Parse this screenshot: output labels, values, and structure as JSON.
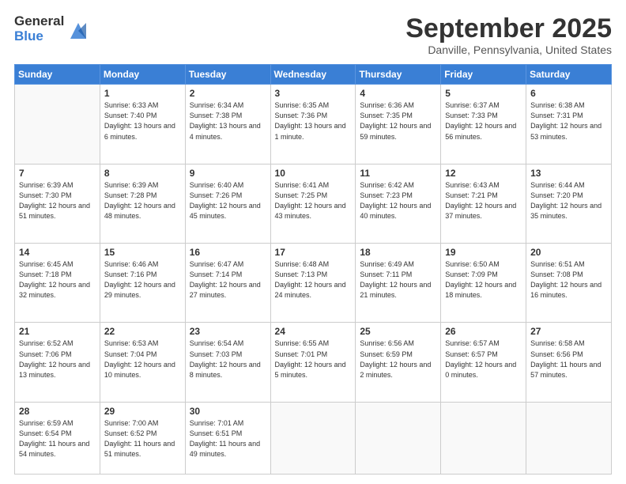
{
  "logo": {
    "general": "General",
    "blue": "Blue"
  },
  "header": {
    "month": "September 2025",
    "location": "Danville, Pennsylvania, United States"
  },
  "weekdays": [
    "Sunday",
    "Monday",
    "Tuesday",
    "Wednesday",
    "Thursday",
    "Friday",
    "Saturday"
  ],
  "weeks": [
    [
      {
        "day": "",
        "sunrise": "",
        "sunset": "",
        "daylight": ""
      },
      {
        "day": "1",
        "sunrise": "Sunrise: 6:33 AM",
        "sunset": "Sunset: 7:40 PM",
        "daylight": "Daylight: 13 hours and 6 minutes."
      },
      {
        "day": "2",
        "sunrise": "Sunrise: 6:34 AM",
        "sunset": "Sunset: 7:38 PM",
        "daylight": "Daylight: 13 hours and 4 minutes."
      },
      {
        "day": "3",
        "sunrise": "Sunrise: 6:35 AM",
        "sunset": "Sunset: 7:36 PM",
        "daylight": "Daylight: 13 hours and 1 minute."
      },
      {
        "day": "4",
        "sunrise": "Sunrise: 6:36 AM",
        "sunset": "Sunset: 7:35 PM",
        "daylight": "Daylight: 12 hours and 59 minutes."
      },
      {
        "day": "5",
        "sunrise": "Sunrise: 6:37 AM",
        "sunset": "Sunset: 7:33 PM",
        "daylight": "Daylight: 12 hours and 56 minutes."
      },
      {
        "day": "6",
        "sunrise": "Sunrise: 6:38 AM",
        "sunset": "Sunset: 7:31 PM",
        "daylight": "Daylight: 12 hours and 53 minutes."
      }
    ],
    [
      {
        "day": "7",
        "sunrise": "Sunrise: 6:39 AM",
        "sunset": "Sunset: 7:30 PM",
        "daylight": "Daylight: 12 hours and 51 minutes."
      },
      {
        "day": "8",
        "sunrise": "Sunrise: 6:39 AM",
        "sunset": "Sunset: 7:28 PM",
        "daylight": "Daylight: 12 hours and 48 minutes."
      },
      {
        "day": "9",
        "sunrise": "Sunrise: 6:40 AM",
        "sunset": "Sunset: 7:26 PM",
        "daylight": "Daylight: 12 hours and 45 minutes."
      },
      {
        "day": "10",
        "sunrise": "Sunrise: 6:41 AM",
        "sunset": "Sunset: 7:25 PM",
        "daylight": "Daylight: 12 hours and 43 minutes."
      },
      {
        "day": "11",
        "sunrise": "Sunrise: 6:42 AM",
        "sunset": "Sunset: 7:23 PM",
        "daylight": "Daylight: 12 hours and 40 minutes."
      },
      {
        "day": "12",
        "sunrise": "Sunrise: 6:43 AM",
        "sunset": "Sunset: 7:21 PM",
        "daylight": "Daylight: 12 hours and 37 minutes."
      },
      {
        "day": "13",
        "sunrise": "Sunrise: 6:44 AM",
        "sunset": "Sunset: 7:20 PM",
        "daylight": "Daylight: 12 hours and 35 minutes."
      }
    ],
    [
      {
        "day": "14",
        "sunrise": "Sunrise: 6:45 AM",
        "sunset": "Sunset: 7:18 PM",
        "daylight": "Daylight: 12 hours and 32 minutes."
      },
      {
        "day": "15",
        "sunrise": "Sunrise: 6:46 AM",
        "sunset": "Sunset: 7:16 PM",
        "daylight": "Daylight: 12 hours and 29 minutes."
      },
      {
        "day": "16",
        "sunrise": "Sunrise: 6:47 AM",
        "sunset": "Sunset: 7:14 PM",
        "daylight": "Daylight: 12 hours and 27 minutes."
      },
      {
        "day": "17",
        "sunrise": "Sunrise: 6:48 AM",
        "sunset": "Sunset: 7:13 PM",
        "daylight": "Daylight: 12 hours and 24 minutes."
      },
      {
        "day": "18",
        "sunrise": "Sunrise: 6:49 AM",
        "sunset": "Sunset: 7:11 PM",
        "daylight": "Daylight: 12 hours and 21 minutes."
      },
      {
        "day": "19",
        "sunrise": "Sunrise: 6:50 AM",
        "sunset": "Sunset: 7:09 PM",
        "daylight": "Daylight: 12 hours and 18 minutes."
      },
      {
        "day": "20",
        "sunrise": "Sunrise: 6:51 AM",
        "sunset": "Sunset: 7:08 PM",
        "daylight": "Daylight: 12 hours and 16 minutes."
      }
    ],
    [
      {
        "day": "21",
        "sunrise": "Sunrise: 6:52 AM",
        "sunset": "Sunset: 7:06 PM",
        "daylight": "Daylight: 12 hours and 13 minutes."
      },
      {
        "day": "22",
        "sunrise": "Sunrise: 6:53 AM",
        "sunset": "Sunset: 7:04 PM",
        "daylight": "Daylight: 12 hours and 10 minutes."
      },
      {
        "day": "23",
        "sunrise": "Sunrise: 6:54 AM",
        "sunset": "Sunset: 7:03 PM",
        "daylight": "Daylight: 12 hours and 8 minutes."
      },
      {
        "day": "24",
        "sunrise": "Sunrise: 6:55 AM",
        "sunset": "Sunset: 7:01 PM",
        "daylight": "Daylight: 12 hours and 5 minutes."
      },
      {
        "day": "25",
        "sunrise": "Sunrise: 6:56 AM",
        "sunset": "Sunset: 6:59 PM",
        "daylight": "Daylight: 12 hours and 2 minutes."
      },
      {
        "day": "26",
        "sunrise": "Sunrise: 6:57 AM",
        "sunset": "Sunset: 6:57 PM",
        "daylight": "Daylight: 12 hours and 0 minutes."
      },
      {
        "day": "27",
        "sunrise": "Sunrise: 6:58 AM",
        "sunset": "Sunset: 6:56 PM",
        "daylight": "Daylight: 11 hours and 57 minutes."
      }
    ],
    [
      {
        "day": "28",
        "sunrise": "Sunrise: 6:59 AM",
        "sunset": "Sunset: 6:54 PM",
        "daylight": "Daylight: 11 hours and 54 minutes."
      },
      {
        "day": "29",
        "sunrise": "Sunrise: 7:00 AM",
        "sunset": "Sunset: 6:52 PM",
        "daylight": "Daylight: 11 hours and 51 minutes."
      },
      {
        "day": "30",
        "sunrise": "Sunrise: 7:01 AM",
        "sunset": "Sunset: 6:51 PM",
        "daylight": "Daylight: 11 hours and 49 minutes."
      },
      {
        "day": "",
        "sunrise": "",
        "sunset": "",
        "daylight": ""
      },
      {
        "day": "",
        "sunrise": "",
        "sunset": "",
        "daylight": ""
      },
      {
        "day": "",
        "sunrise": "",
        "sunset": "",
        "daylight": ""
      },
      {
        "day": "",
        "sunrise": "",
        "sunset": "",
        "daylight": ""
      }
    ]
  ]
}
